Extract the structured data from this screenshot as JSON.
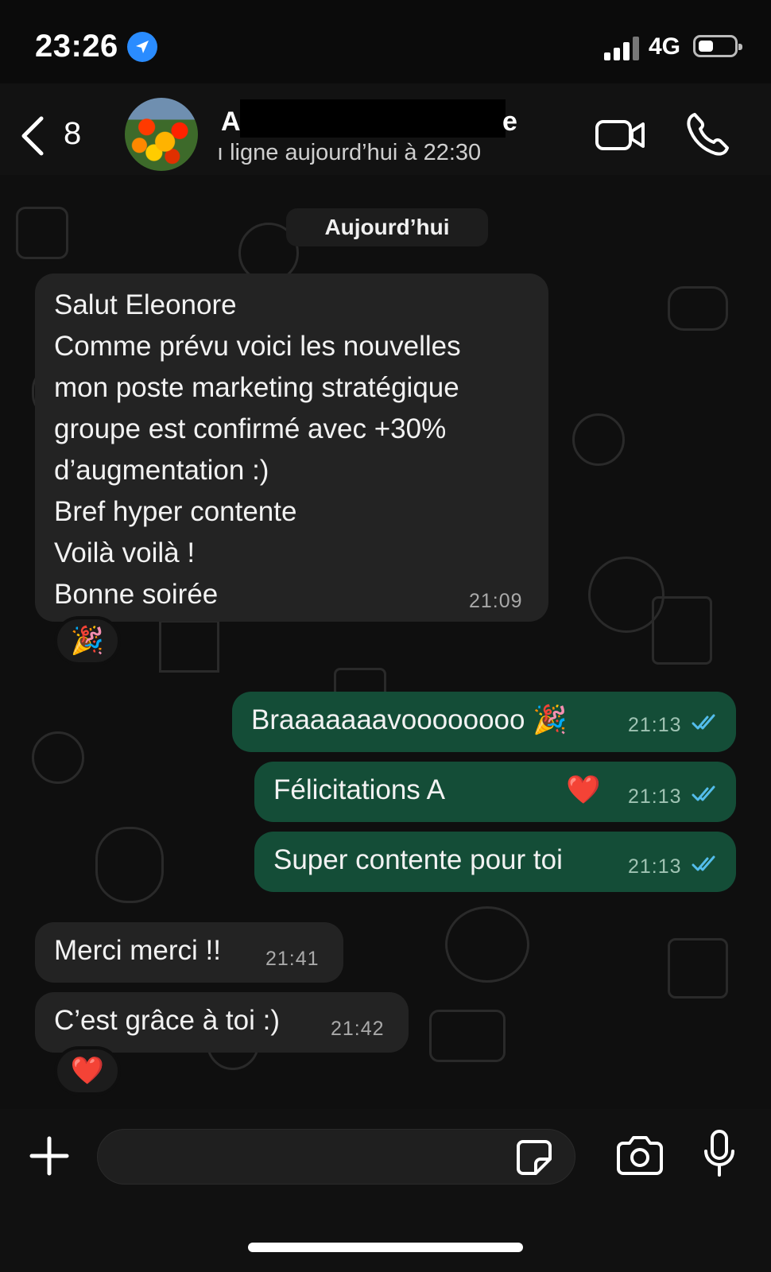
{
  "status_bar": {
    "time": "23:26",
    "network": "4G"
  },
  "header": {
    "back_count": "8",
    "contact_name_start": "A",
    "contact_name_end": "e",
    "contact_status": "ı ligne aujourd’hui à 22:30"
  },
  "chat": {
    "date_label": "Aujourd’hui",
    "messages": [
      {
        "direction": "incoming",
        "text": "Salut Eleonore\nComme prévu voici les nouvelles\nmon poste marketing stratégique\ngroupe est confirmé avec +30%\nd’augmentation :)\nBref hyper contente\nVoilà voilà !\nBonne soirée",
        "time": "21:09",
        "reaction": "🎉"
      },
      {
        "direction": "outgoing",
        "text": "Braaaaaaavoooooooo 🎉",
        "time": "21:13",
        "status": "read"
      },
      {
        "direction": "outgoing",
        "text": "Félicitations A",
        "emoji": "❤️",
        "time": "21:13",
        "status": "read"
      },
      {
        "direction": "outgoing",
        "text": "Super contente pour toi",
        "time": "21:13",
        "status": "read"
      },
      {
        "direction": "incoming",
        "text": "Merci merci !!",
        "time": "21:41"
      },
      {
        "direction": "incoming",
        "text": "C’est grâce à toi :)",
        "time": "21:42",
        "reaction": "❤️"
      }
    ]
  },
  "input": {
    "value": "",
    "placeholder": ""
  },
  "colors": {
    "outgoing_bubble": "#144d37",
    "incoming_bubble": "#232323",
    "read_ticks": "#53bdeb",
    "location_badge": "#2a8cff"
  },
  "icons": [
    "location-arrow-icon",
    "signal-icon",
    "battery-icon",
    "back-chevron-icon",
    "video-call-icon",
    "phone-call-icon",
    "plus-icon",
    "sticker-icon",
    "camera-icon",
    "microphone-icon",
    "double-check-icon"
  ]
}
